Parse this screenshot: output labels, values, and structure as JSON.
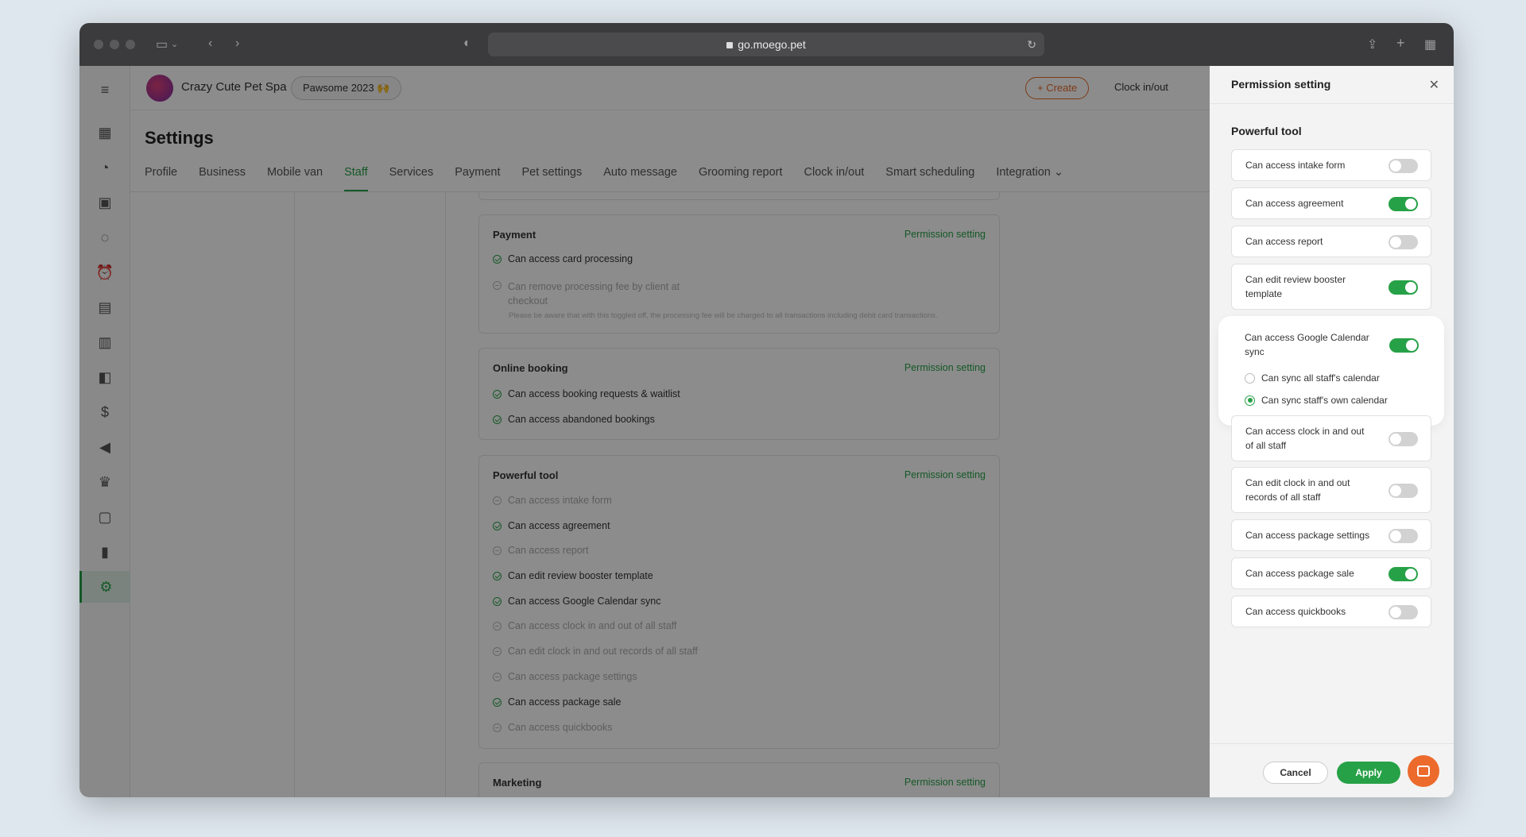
{
  "browser": {
    "url": "go.moego.pet"
  },
  "header": {
    "business_name": "Crazy Cute Pet Spa",
    "pill": "Pawsome 2023 🙌",
    "create": "+ Create",
    "clock": "Clock in/out"
  },
  "page": {
    "title": "Settings",
    "tabs": [
      "Profile",
      "Business",
      "Mobile van",
      "Staff",
      "Services",
      "Payment",
      "Pet settings",
      "Auto message",
      "Grooming report",
      "Clock in/out",
      "Smart scheduling",
      "Integration"
    ],
    "active_tab": "Staff"
  },
  "cards": {
    "perm_link": "Permission setting",
    "payment": {
      "title": "Payment",
      "items": [
        {
          "label": "Can access card processing",
          "on": true
        },
        {
          "label": "Can remove processing fee by client at checkout",
          "on": false
        }
      ],
      "note": "Please be aware that with this toggled off, the processing fee will be charged to all transactions including debit card transactions."
    },
    "online_booking": {
      "title": "Online booking",
      "items": [
        {
          "label": "Can access booking requests & waitlist",
          "on": true
        },
        {
          "label": "Can access abandoned bookings",
          "on": true
        }
      ]
    },
    "powerful_tool": {
      "title": "Powerful tool",
      "items": [
        {
          "label": "Can access intake form",
          "on": false
        },
        {
          "label": "Can access agreement",
          "on": true
        },
        {
          "label": "Can access report",
          "on": false
        },
        {
          "label": "Can edit review booster template",
          "on": true
        },
        {
          "label": "Can access Google Calendar sync",
          "on": true
        },
        {
          "label": "Can access clock in and out of all staff",
          "on": false
        },
        {
          "label": "Can edit clock in and out records of all staff",
          "on": false
        },
        {
          "label": "Can access package settings",
          "on": false
        },
        {
          "label": "Can access package sale",
          "on": true
        },
        {
          "label": "Can access quickbooks",
          "on": false
        }
      ]
    },
    "marketing": {
      "title": "Marketing"
    }
  },
  "drawer": {
    "title": "Permission setting",
    "section": "Powerful tool",
    "options": [
      {
        "label": "Can access intake form",
        "on": false
      },
      {
        "label": "Can access agreement",
        "on": true
      },
      {
        "label": "Can access report",
        "on": false
      },
      {
        "label": "Can edit review booster template",
        "on": true
      },
      {
        "label": "Can access Google Calendar sync",
        "on": true
      },
      {
        "label": "Can access clock in and out of all staff",
        "on": false
      },
      {
        "label": "Can edit clock in and out records of all staff",
        "on": false
      },
      {
        "label": "Can access package settings",
        "on": false
      },
      {
        "label": "Can access package sale",
        "on": true
      },
      {
        "label": "Can access quickbooks",
        "on": false
      }
    ],
    "calendar_radios": [
      {
        "label": "Can sync all staff's calendar",
        "selected": false
      },
      {
        "label": "Can sync staff's own calendar",
        "selected": true
      }
    ],
    "cancel": "Cancel",
    "apply": "Apply"
  },
  "colors": {
    "accent": "#27a147",
    "orange": "#ec6a2c"
  }
}
